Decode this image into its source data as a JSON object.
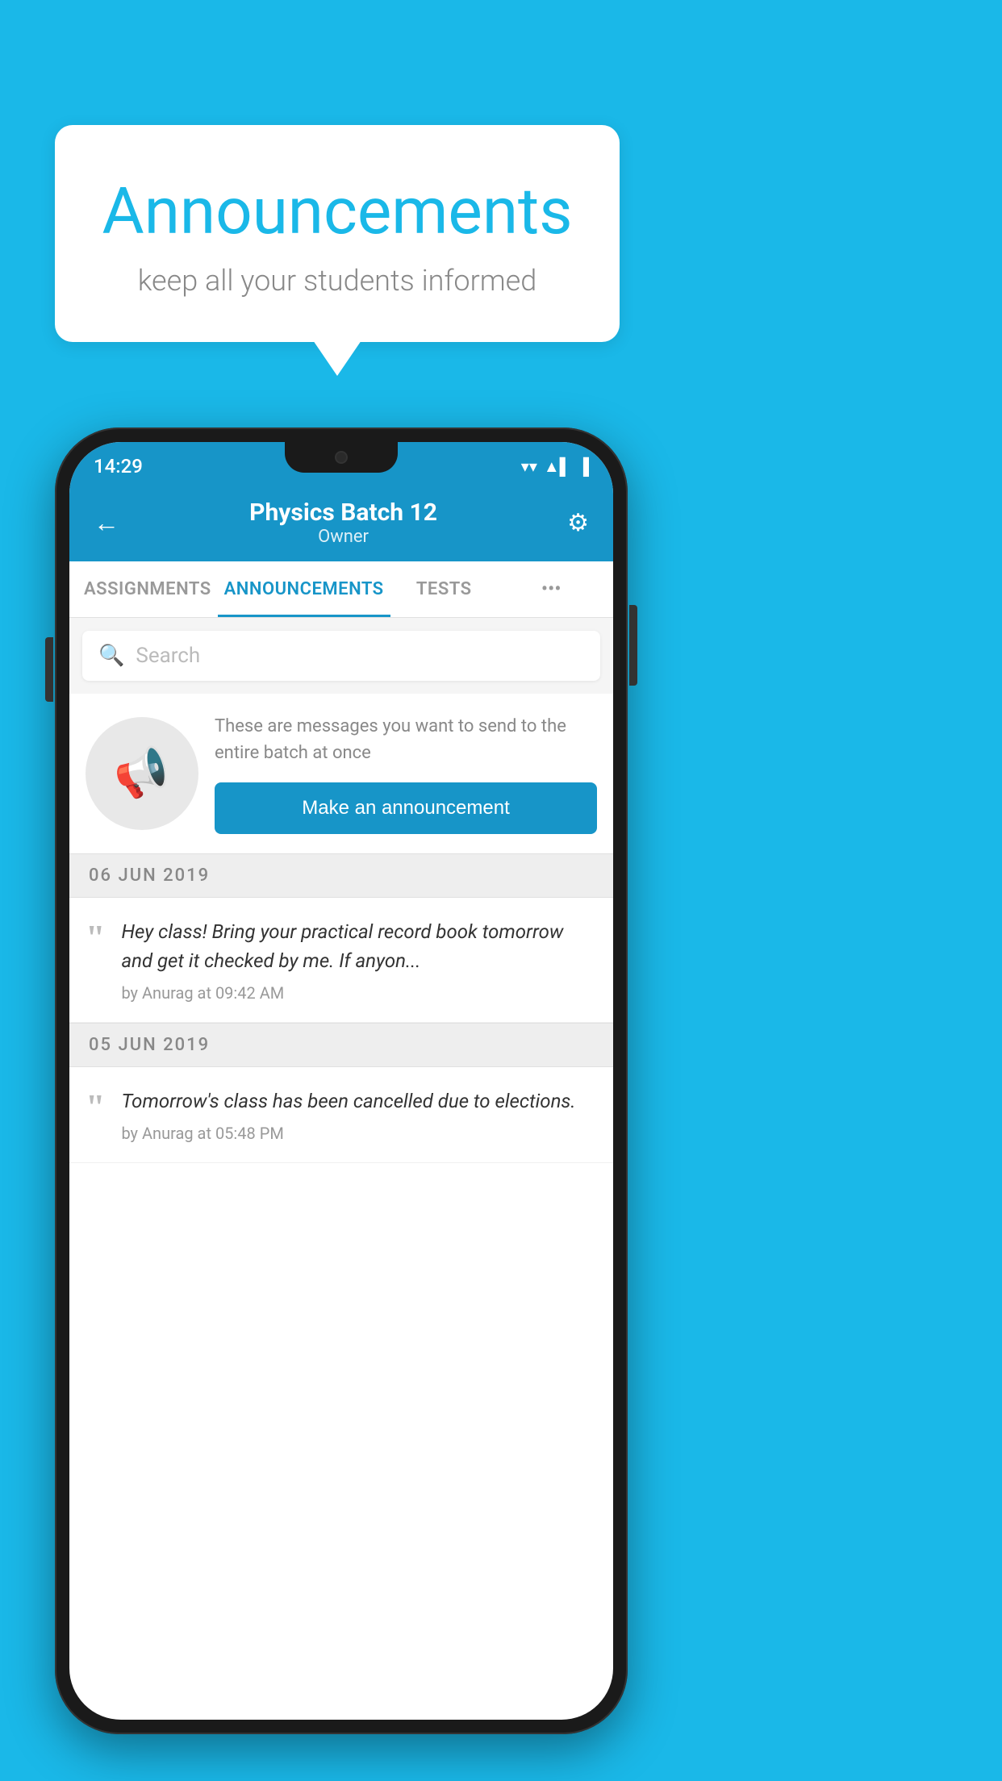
{
  "background_color": "#1ab8e8",
  "speech_bubble": {
    "title": "Announcements",
    "subtitle": "keep all your students informed"
  },
  "status_bar": {
    "time": "14:29",
    "wifi": "▾",
    "signal": "▲",
    "battery": "▐"
  },
  "header": {
    "title": "Physics Batch 12",
    "subtitle": "Owner",
    "back_label": "←",
    "gear_label": "⚙"
  },
  "tabs": [
    {
      "label": "ASSIGNMENTS",
      "active": false
    },
    {
      "label": "ANNOUNCEMENTS",
      "active": true
    },
    {
      "label": "TESTS",
      "active": false
    },
    {
      "label": "•••",
      "active": false
    }
  ],
  "search": {
    "placeholder": "Search"
  },
  "promo": {
    "description": "These are messages you want to send to the entire batch at once",
    "button_label": "Make an announcement"
  },
  "announcements": [
    {
      "date": "06  JUN  2019",
      "text": "Hey class! Bring your practical record book tomorrow and get it checked by me. If anyon...",
      "author": "by Anurag at 09:42 AM"
    },
    {
      "date": "05  JUN  2019",
      "text": "Tomorrow's class has been cancelled due to elections.",
      "author": "by Anurag at 05:48 PM"
    }
  ]
}
